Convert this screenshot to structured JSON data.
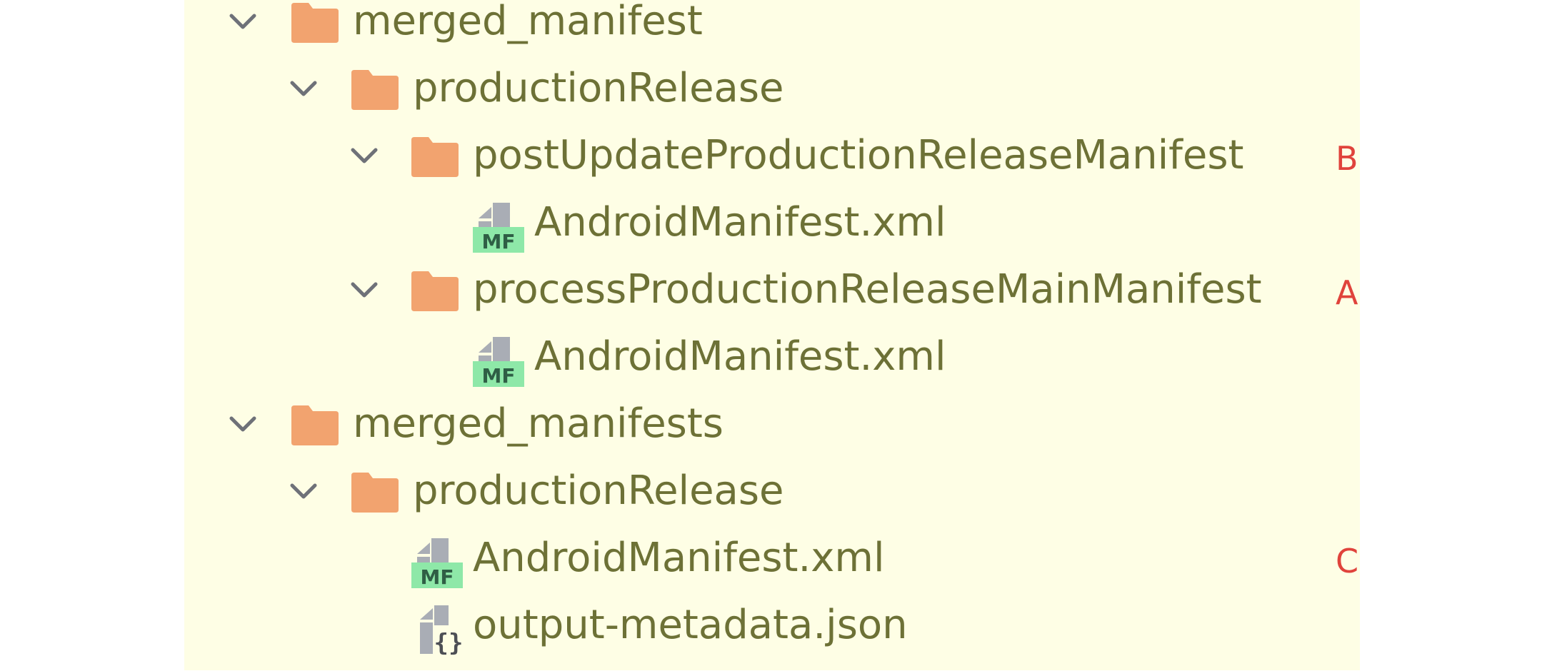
{
  "tree": {
    "nodes": [
      {
        "label": "merged_manifest",
        "kind": "folder",
        "expanded": true,
        "marker": ""
      },
      {
        "label": "productionRelease",
        "kind": "folder",
        "expanded": true,
        "marker": ""
      },
      {
        "label": "postUpdateProductionReleaseManifest",
        "kind": "folder",
        "expanded": true,
        "marker": "B"
      },
      {
        "label": "AndroidManifest.xml",
        "kind": "manifest-file",
        "icon_text": "MF",
        "marker": ""
      },
      {
        "label": "processProductionReleaseMainManifest",
        "kind": "folder",
        "expanded": true,
        "marker": "A"
      },
      {
        "label": "AndroidManifest.xml",
        "kind": "manifest-file",
        "icon_text": "MF",
        "marker": ""
      },
      {
        "label": "merged_manifests",
        "kind": "folder",
        "expanded": true,
        "marker": ""
      },
      {
        "label": "productionRelease",
        "kind": "folder",
        "expanded": true,
        "marker": ""
      },
      {
        "label": "AndroidManifest.xml",
        "kind": "manifest-file",
        "icon_text": "MF",
        "marker": "C"
      },
      {
        "label": "output-metadata.json",
        "kind": "json-file",
        "icon_text": "{}",
        "marker": ""
      }
    ]
  },
  "colors": {
    "panel_background": "#fefee5",
    "label_text": "#6d7136",
    "folder": "#f2a36f",
    "chevron": "#6e7178",
    "marker": "#e0433b",
    "manifest_badge": "#8ee8a8",
    "file_gray": "#a9adb5"
  },
  "icons": {
    "chevron": "chevron-down-icon",
    "folder": "folder-icon",
    "manifest": "manifest-file-icon",
    "json": "json-file-icon"
  }
}
